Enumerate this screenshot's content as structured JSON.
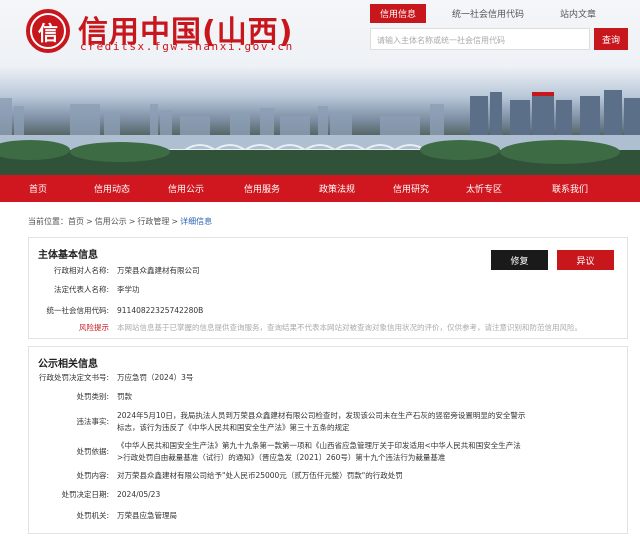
{
  "header": {
    "logo_char": "信",
    "title": "信用中国(山西)",
    "domain": "creditsx.fgw.shanxi.gov.cn",
    "search_tabs": [
      "信用信息",
      "统一社会信用代码",
      "站内文章"
    ],
    "search_placeholder": "请输入主体名称或统一社会信用代码",
    "search_button": "查询"
  },
  "nav": [
    "首页",
    "信用动态",
    "信用公示",
    "信用服务",
    "政策法规",
    "信用研究",
    "太忻专区",
    "联系我们"
  ],
  "breadcrumb": {
    "prefix": "当前位置：",
    "items": [
      "首页",
      "信用公示",
      "行政管理",
      "详细信息"
    ],
    "separator": ">"
  },
  "basic": {
    "title": "主体基本信息",
    "fix_button": "修复",
    "objection_button": "异议",
    "rows": [
      {
        "label": "行政相对人名称:",
        "value": "万荣县众鑫建材有限公司"
      },
      {
        "label": "法定代表人名称:",
        "value": "李学功"
      },
      {
        "label": "统一社会信用代码:",
        "value": "91140822325742280B"
      },
      {
        "label": "风险提示",
        "value": "本网站信息基于已掌握的信息提供查询服务，查询结果不代表本网站对被查询对象信用状况的评价，仅供参考，请注意识别和防范信用风险。"
      }
    ]
  },
  "public": {
    "title": "公示相关信息",
    "rows": [
      {
        "label": "行政处罚决定文书号:",
        "value": "万应急罚（2024）3号"
      },
      {
        "label": "处罚类别:",
        "value": "罚款"
      },
      {
        "label": "违法事实:",
        "value": "2024年5月10日，我局执法人员到万荣县众鑫建材有限公司检查时，发现该公司未在生产石灰的竖窑旁设置明显的安全警示标志，该行为违反了《中华人民共和国安全生产法》第三十五条的规定"
      },
      {
        "label": "处罚依据:",
        "value": "《中华人民共和国安全生产法》第九十九条第一款第一项和《山西省应急管理厅关于印发适用<中华人民共和国安全生产法>行政处罚自由裁量基准（试行）的通知》（晋应急发〔2021〕260号）第十九个违法行为裁量基准"
      },
      {
        "label": "处罚内容:",
        "value": "对万荣县众鑫建材有限公司给予\"处人民币25000元（贰万伍仟元整）罚款\"的行政处罚"
      },
      {
        "label": "处罚决定日期:",
        "value": "2024/05/23"
      },
      {
        "label": "处罚机关:",
        "value": "万荣县应急管理局"
      }
    ]
  },
  "colors": {
    "brand_red": "#c8161d",
    "link_blue": "#2a62b5"
  }
}
